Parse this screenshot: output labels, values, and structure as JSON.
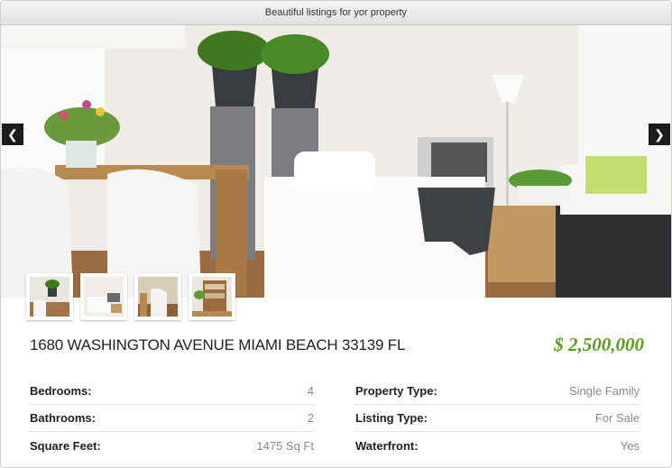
{
  "header": {
    "title": "Beautiful listings for yor property"
  },
  "gallery": {
    "prev_icon": "chevron-left-icon",
    "next_icon": "chevron-right-icon",
    "thumbnails": [
      "dining-room-thumbnail",
      "living-room-thumbnail",
      "chairs-thumbnail",
      "shelf-thumbnail"
    ]
  },
  "listing": {
    "address": "1680 WASHINGTON AVENUE MIAMI BEACH 33139 FL",
    "price": "$ 2,500,000",
    "specs_left": [
      {
        "label": "Bedrooms:",
        "value": "4"
      },
      {
        "label": "Bathrooms:",
        "value": "2"
      },
      {
        "label": "Square Feet:",
        "value": "1475 Sq Ft"
      }
    ],
    "specs_right": [
      {
        "label": "Property Type:",
        "value": "Single Family"
      },
      {
        "label": "Listing Type:",
        "value": "For Sale"
      },
      {
        "label": "Waterfront:",
        "value": "Yes"
      }
    ]
  },
  "colors": {
    "price": "#5a9e1f",
    "arrow_bg": "#1c1c1c"
  }
}
